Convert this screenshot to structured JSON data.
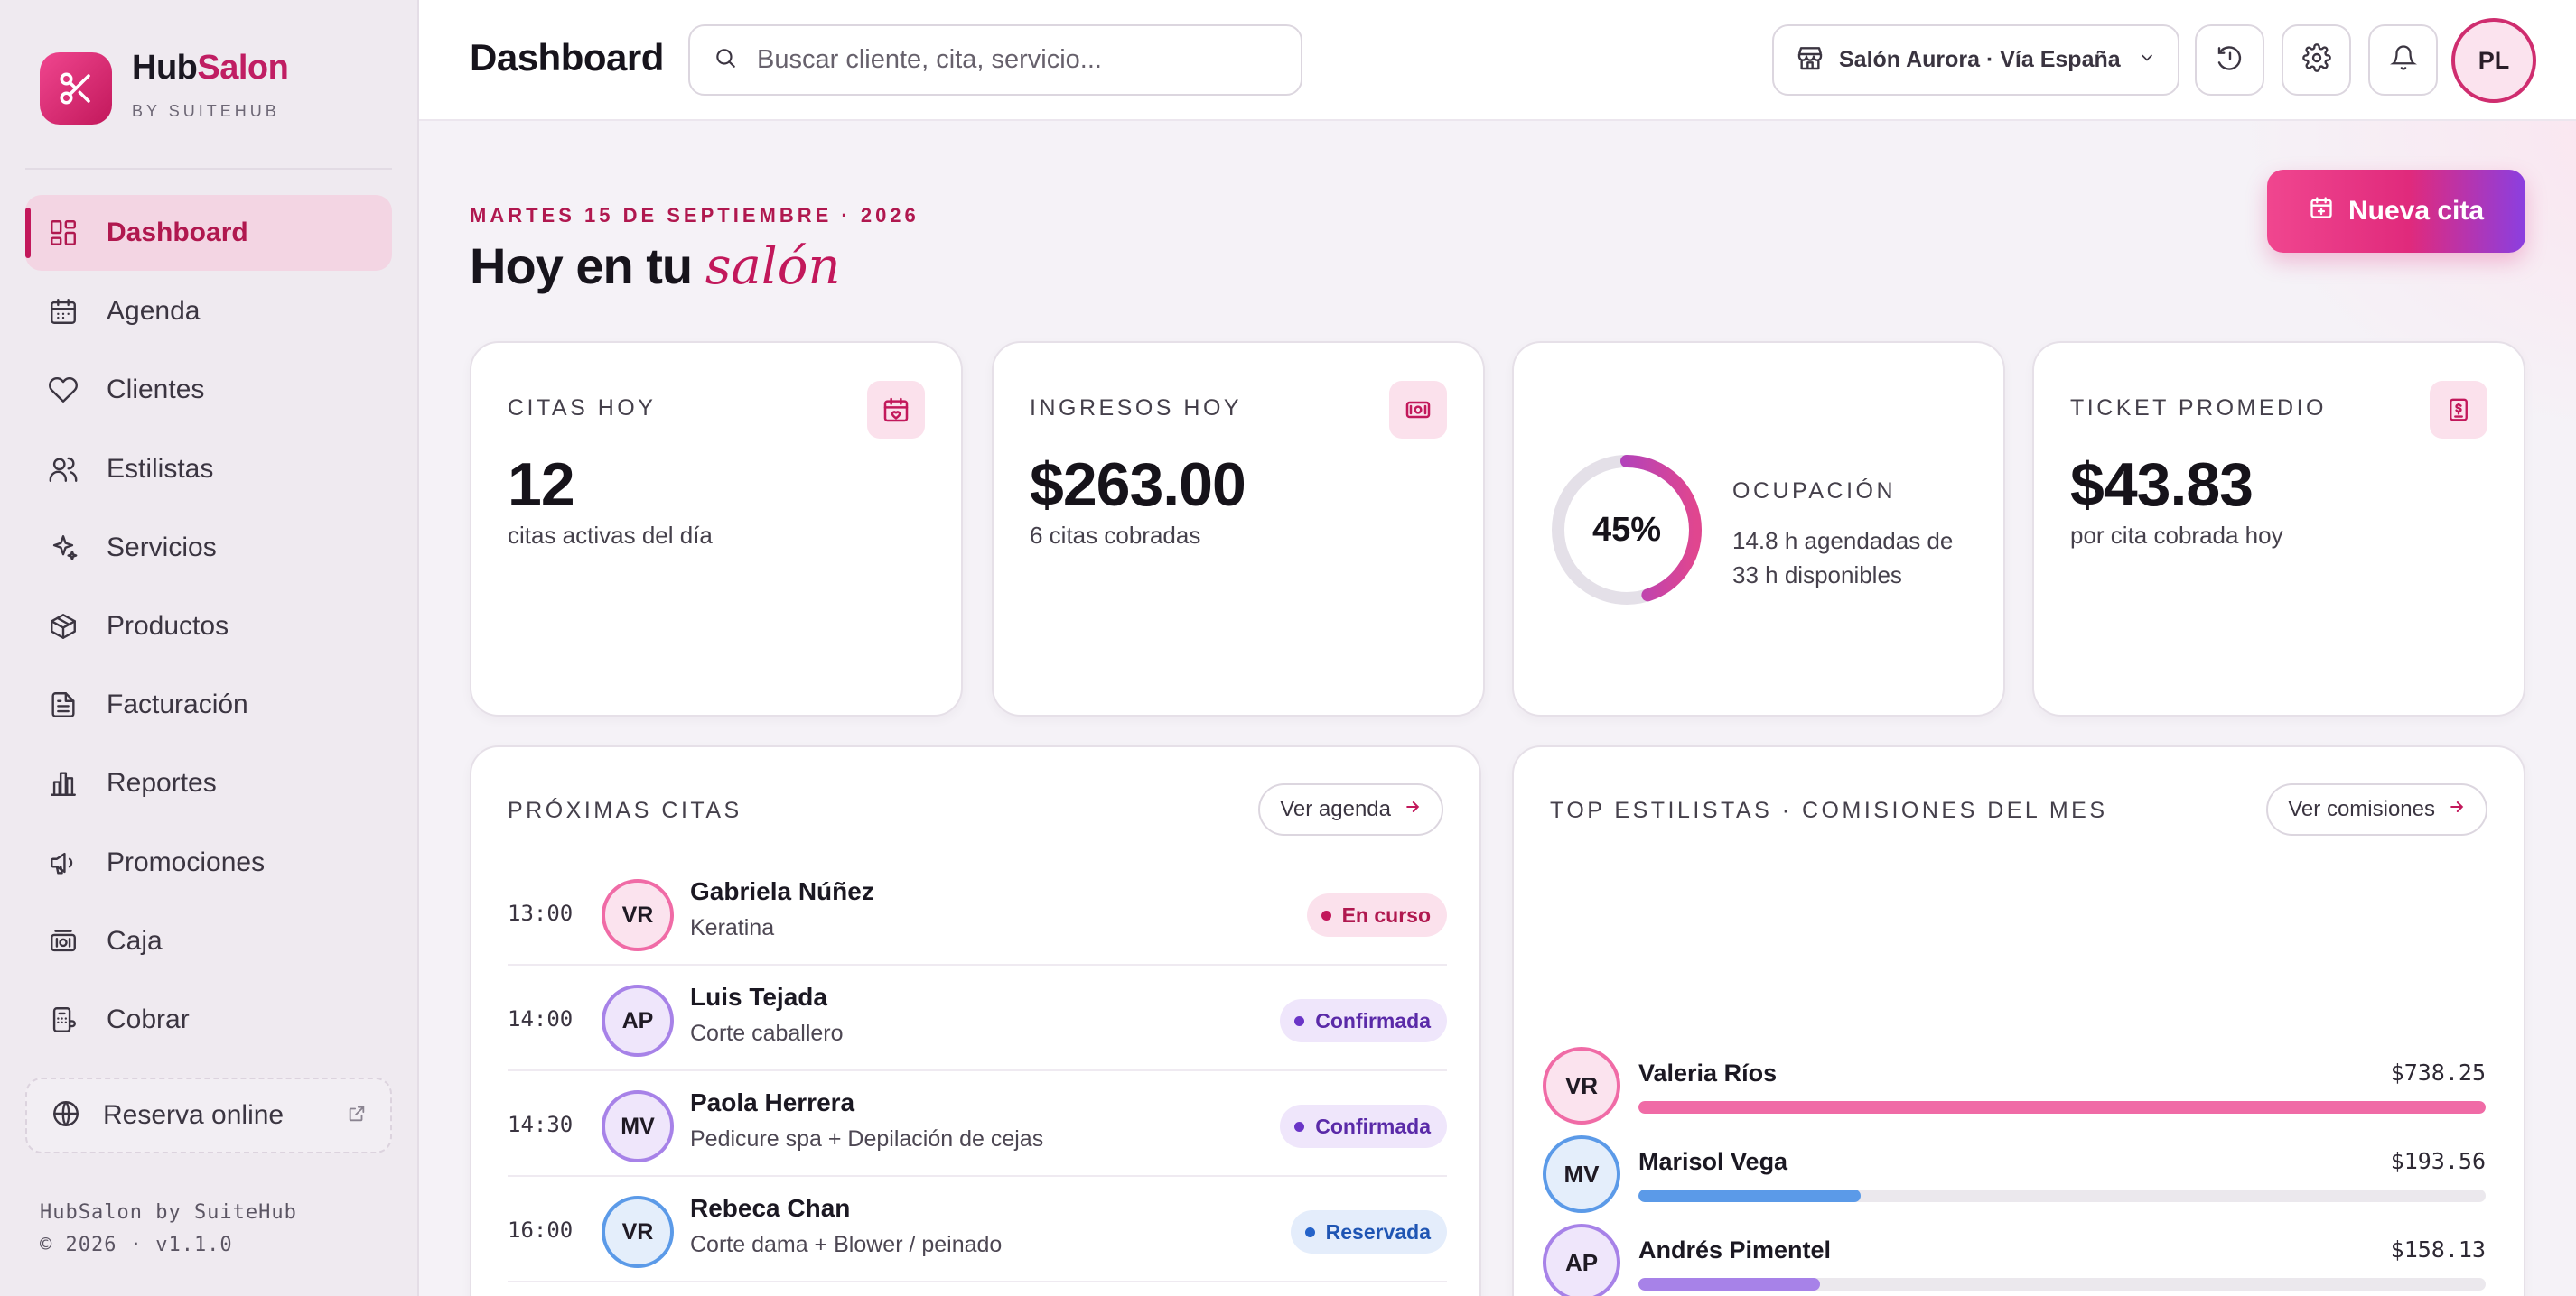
{
  "brand": {
    "name_part1": "Hub",
    "name_part2": "Salon",
    "subtitle": "BY SUITEHUB"
  },
  "nav": [
    {
      "label": "Dashboard",
      "icon": "dashboard-icon",
      "active": true
    },
    {
      "label": "Agenda",
      "icon": "calendar-icon"
    },
    {
      "label": "Clientes",
      "icon": "heart-icon"
    },
    {
      "label": "Estilistas",
      "icon": "users-icon"
    },
    {
      "label": "Servicios",
      "icon": "sparkles-icon"
    },
    {
      "label": "Productos",
      "icon": "package-icon"
    },
    {
      "label": "Facturación",
      "icon": "invoice-icon"
    },
    {
      "label": "Reportes",
      "icon": "bar-chart-icon"
    },
    {
      "label": "Promociones",
      "icon": "megaphone-icon"
    },
    {
      "label": "Caja",
      "icon": "cash-register-icon"
    },
    {
      "label": "Cobrar",
      "icon": "payment-icon"
    }
  ],
  "reserva": {
    "label": "Reserva online"
  },
  "footer": {
    "line1": "HubSalon by SuiteHub",
    "line2": "© 2026 · v1.1.0"
  },
  "topbar": {
    "title": "Dashboard",
    "search_placeholder": "Buscar cliente, cita, servicio...",
    "salon": "Salón Aurora · Vía España",
    "user_initials": "PL"
  },
  "hero": {
    "date": "MARTES 15 DE SEPTIEMBRE · 2026",
    "greeting_plain": "Hoy en tu",
    "greeting_em": "salón",
    "new_button": "Nueva cita"
  },
  "kpis": {
    "citas": {
      "label": "CITAS HOY",
      "value": "12",
      "sub": "citas activas del día"
    },
    "ingresos": {
      "label": "INGRESOS HOY",
      "value": "$263.00",
      "sub": "6 citas cobradas"
    },
    "ocupacion": {
      "label": "OCUPACIÓN",
      "percent": 45,
      "percent_label": "45%",
      "sub": "14.8 h agendadas de 33 h disponibles"
    },
    "ticket": {
      "label": "TICKET PROMEDIO",
      "value": "$43.83",
      "sub": "por cita cobrada hoy"
    }
  },
  "proximas": {
    "title": "PRÓXIMAS CITAS",
    "link": "Ver agenda",
    "items": [
      {
        "time": "13:00",
        "initials": "VR",
        "name": "Gabriela Núñez",
        "service": "Keratina",
        "status": "En curso",
        "tone": "pink"
      },
      {
        "time": "14:00",
        "initials": "AP",
        "name": "Luis Tejada",
        "service": "Corte caballero",
        "status": "Confirmada",
        "tone": "purple"
      },
      {
        "time": "14:30",
        "initials": "MV",
        "name": "Paola Herrera",
        "service": "Pedicure spa + Depilación de cejas",
        "status": "Confirmada",
        "tone": "purple"
      },
      {
        "time": "16:00",
        "initials": "VR",
        "name": "Rebeca Chan",
        "service": "Corte dama + Blower / peinado",
        "status": "Reservada",
        "tone": "blue"
      }
    ]
  },
  "estilistas": {
    "title": "TOP ESTILISTAS · COMISIONES DEL MES",
    "link": "Ver comisiones",
    "items": [
      {
        "initials": "VR",
        "name": "Valeria Ríos",
        "amount": "$738.25",
        "fraction": 1.0,
        "tone": "pink"
      },
      {
        "initials": "MV",
        "name": "Marisol Vega",
        "amount": "$193.56",
        "fraction": 0.262,
        "tone": "blue"
      },
      {
        "initials": "AP",
        "name": "Andrés Pimentel",
        "amount": "$158.13",
        "fraction": 0.214,
        "tone": "purple"
      }
    ]
  },
  "colors": {
    "accent": "#c2185b",
    "pink": "#f06ba6",
    "blue": "#5b9ae8",
    "purple": "#a782e8"
  }
}
